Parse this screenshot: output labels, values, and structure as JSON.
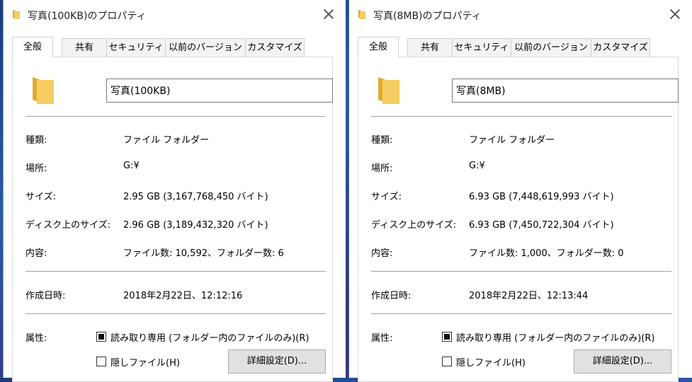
{
  "colors": {
    "folder": "#f5cd63",
    "folder_dark": "#e0ac2f",
    "accent_border": "#7aa8d6"
  },
  "icons": {
    "folder": "folder-icon",
    "close": "close-icon"
  },
  "windows": [
    {
      "title": "写真(100KB)のプロパティ",
      "tabs": [
        "全般",
        "共有",
        "セキュリティ",
        "以前のバージョン",
        "カスタマイズ"
      ],
      "name": "写真(100KB)",
      "labels": {
        "type": "種類:",
        "location": "場所:",
        "size": "サイズ:",
        "disk_size": "ディスク上のサイズ:",
        "contents": "内容:",
        "created": "作成日時:",
        "attributes": "属性:"
      },
      "values": {
        "type": "ファイル フォルダー",
        "location": "G:¥",
        "size": "2.95 GB (3,167,768,450 バイト)",
        "disk_size": "2.96 GB (3,189,432,320 バイト)",
        "contents": "ファイル数: 10,592、フォルダー数: 6",
        "created": "2018年2月22日、12:12:16"
      },
      "readonly_label": "読み取り専用 (フォルダー内のファイルのみ)(R)",
      "readonly_checked": true,
      "hidden_label": "隠しファイル(H)",
      "hidden_checked": false,
      "advanced_button": "詳細設定(D)..."
    },
    {
      "title": "写真(8MB)のプロパティ",
      "tabs": [
        "全般",
        "共有",
        "セキュリティ",
        "以前のバージョン",
        "カスタマイズ"
      ],
      "name": "写真(8MB)",
      "labels": {
        "type": "種類:",
        "location": "場所:",
        "size": "サイズ:",
        "disk_size": "ディスク上のサイズ:",
        "contents": "内容:",
        "created": "作成日時:",
        "attributes": "属性:"
      },
      "values": {
        "type": "ファイル フォルダー",
        "location": "G:¥",
        "size": "6.93 GB (7,448,619,993 バイト)",
        "disk_size": "6.93 GB (7,450,722,304 バイト)",
        "contents": "ファイル数: 1,000、フォルダー数: 0",
        "created": "2018年2月22日、12:13:44"
      },
      "readonly_label": "読み取り専用 (フォルダー内のファイルのみ)(R)",
      "readonly_checked": true,
      "hidden_label": "隠しファイル(H)",
      "hidden_checked": false,
      "advanced_button": "詳細設定(D)..."
    }
  ]
}
